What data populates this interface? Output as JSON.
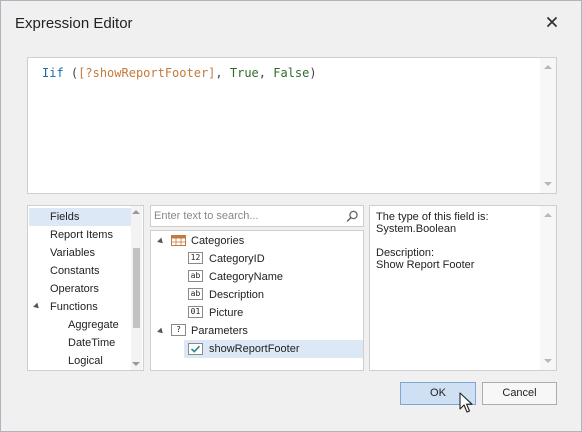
{
  "dialog": {
    "title": "Expression Editor",
    "close_icon": "close-icon"
  },
  "editor": {
    "tokens": {
      "iif": "Iif",
      "open_paren": " (",
      "field": "[?showReportFooter]",
      "comma1": ", ",
      "true": "True",
      "comma2": ", ",
      "false": "False",
      "close_paren": ")"
    }
  },
  "categories_list": {
    "items": [
      "Fields",
      "Report Items",
      "Variables",
      "Constants",
      "Operators",
      "Functions",
      "Aggregate",
      "DateTime",
      "Logical"
    ],
    "selected": "Fields"
  },
  "search": {
    "placeholder": "Enter text to search...",
    "value": "",
    "icon": "search-icon"
  },
  "tree": {
    "categories_label": "Categories",
    "fields": [
      {
        "icon_text": "12",
        "label": "CategoryID"
      },
      {
        "icon_text": "ab",
        "label": "CategoryName"
      },
      {
        "icon_text": "ab",
        "label": "Description"
      },
      {
        "icon_text": "01",
        "label": "Picture"
      }
    ],
    "parameters_label": "Parameters",
    "parameters_icon_text": "?",
    "parameter": {
      "label": "showReportFooter",
      "icon": "check-icon",
      "selected": true
    }
  },
  "description": {
    "text": "The type of this field is:\nSystem.Boolean\n\nDescription:\nShow Report Footer"
  },
  "buttons": {
    "ok": "OK",
    "cancel": "Cancel"
  },
  "colors": {
    "selection": "#dde8f7",
    "ok_button": "#cfe0f5",
    "keyword": "#1a6aa8",
    "field": "#c47a3c",
    "literal": "#2e6c2e"
  }
}
